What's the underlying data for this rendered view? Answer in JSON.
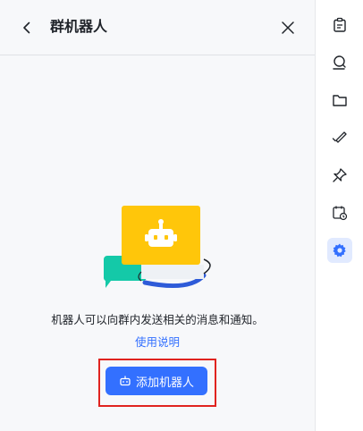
{
  "header": {
    "title": "群机器人",
    "back_icon": "chevron-left-icon",
    "close_icon": "close-icon"
  },
  "main": {
    "description": "机器人可以向群内发送相关的消息和通知。",
    "help_link": "使用说明",
    "add_button_label": "添加机器人",
    "add_button_icon": "robot-icon"
  },
  "sidebar": {
    "items": [
      {
        "icon": "clipboard-icon",
        "active": false
      },
      {
        "icon": "search-message-icon",
        "active": false
      },
      {
        "icon": "folder-icon",
        "active": false
      },
      {
        "icon": "pen-check-icon",
        "active": false
      },
      {
        "icon": "pin-icon",
        "active": false
      },
      {
        "icon": "calendar-clock-icon",
        "active": false
      },
      {
        "icon": "gear-icon",
        "active": true
      }
    ]
  },
  "colors": {
    "accent": "#3370ff",
    "highlight": "#e0231f",
    "illustration_yellow": "#ffc60a",
    "illustration_teal": "#14c9a8",
    "text_primary": "#1f2329"
  }
}
